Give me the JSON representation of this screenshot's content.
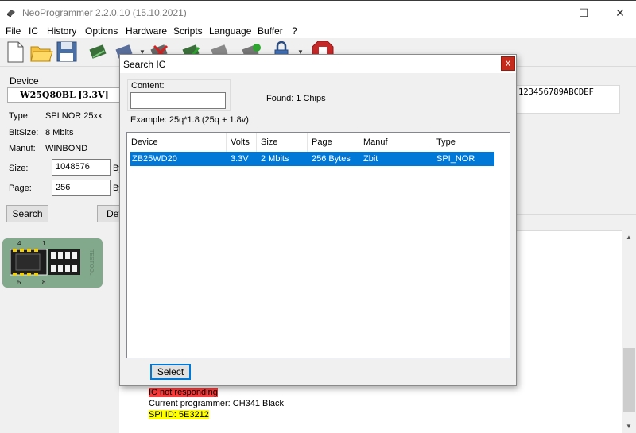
{
  "window": {
    "title": "NeoProgrammer 2.2.0.10 (15.10.2021)"
  },
  "menu": [
    "File",
    "IC",
    "History",
    "Options",
    "Hardware",
    "Scripts",
    "Language",
    "Buffer",
    "?"
  ],
  "device": {
    "legend": "Device",
    "chip": "W25Q80BL [3.3V]",
    "type_label": "Type:",
    "type_value": "SPI NOR 25xx",
    "bitsize_label": "BitSize:",
    "bitsize_value": "8 Mbits",
    "manuf_label": "Manuf:",
    "manuf_value": "WINBOND",
    "size_label": "Size:",
    "size_value": "1048576",
    "size_unit": "By",
    "page_label": "Page:",
    "page_value": "256",
    "page_unit": "By",
    "search_btn": "Search",
    "detect_btn": "Det"
  },
  "chip_board": {
    "pin4": "4",
    "pin1": "1",
    "pin5": "5",
    "pin8": "8",
    "brand": "TESTOOL"
  },
  "hex_header": "123456789ABCDEF",
  "log": {
    "lines": [
      {
        "text": "IC not responding",
        "bg": "#ff3b3b"
      },
      {
        "text": "Current programmer: CH341 Black",
        "bg": ""
      },
      {
        "text": "SPI ID: 5E3212",
        "bg": "#ffff00"
      }
    ]
  },
  "dialog": {
    "title": "Search IC",
    "close": "x",
    "content_label": "Content:",
    "content_value": "",
    "found": "Found: 1 Chips",
    "example": "Example:  25q*1.8 (25q + 1.8v)",
    "columns": [
      "Device",
      "Volts",
      "Size",
      "Page",
      "Manuf",
      "Type"
    ],
    "rows": [
      [
        "ZB25WD20",
        "3.3V",
        "2 Mbits",
        "256 Bytes",
        "Zbit",
        "SPI_NOR"
      ]
    ],
    "select_btn": "Select"
  },
  "colors": {
    "selection": "#0078d7",
    "close_red": "#c42b1c",
    "board_green": "#82a98c"
  }
}
